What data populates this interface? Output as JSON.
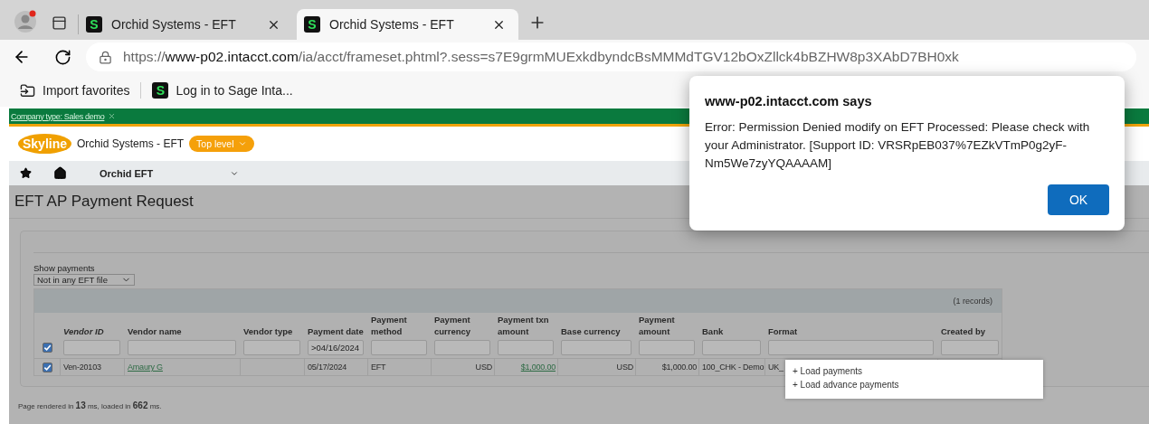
{
  "browser": {
    "tabs": [
      {
        "icon_letter": "S",
        "title": "Orchid Systems - EFT",
        "selected": false
      },
      {
        "icon_letter": "S",
        "title": "Orchid Systems - EFT",
        "selected": true
      }
    ],
    "address": {
      "scheme": "https://",
      "host": "www-p02.intacct.com",
      "path": "/ia/acct/frameset.phtml?.sess=s7E9grmMUExkdbyndcBsMMMdTGV12bOxZllck4bBZHW8p3XAbD7BH0xk"
    },
    "bookmarks": [
      {
        "kind": "import",
        "label": "Import favorites"
      },
      {
        "kind": "site",
        "icon_letter": "S",
        "label": "Log in to Sage Inta..."
      }
    ]
  },
  "banner": {
    "label": "Company type: Sales demo"
  },
  "header": {
    "logo": "Skyline",
    "company": "Orchid Systems - EFT",
    "level": "Top level"
  },
  "nav": {
    "menu": "Orchid EFT"
  },
  "page": {
    "title": "EFT AP Payment Request",
    "show_payments": {
      "label": "Show payments",
      "value": "Not in any EFT file"
    },
    "table": {
      "records": "(1 records)",
      "select_all": true,
      "columns": [
        {
          "label": "Vendor ID",
          "sorted": true
        },
        {
          "label": "Vendor name",
          "sorted": false
        },
        {
          "label": "Vendor type",
          "sorted": false
        },
        {
          "label": "Payment date",
          "sorted": false,
          "filter": ">04/16/2024"
        },
        {
          "label": "Payment method",
          "sorted": false
        },
        {
          "label": "Payment currency",
          "sorted": false
        },
        {
          "label": "Payment txn amount",
          "sorted": false
        },
        {
          "label": "Base currency",
          "sorted": false
        },
        {
          "label": "Payment amount",
          "sorted": false
        },
        {
          "label": "Bank",
          "sorted": false
        },
        {
          "label": "Format",
          "sorted": false
        },
        {
          "label": "Created by",
          "sorted": false
        }
      ],
      "rows": [
        {
          "selected": true,
          "cells": [
            {
              "kind": "text",
              "text": "Ven-20103"
            },
            {
              "kind": "link",
              "text": "Amaury G"
            },
            {
              "kind": "text",
              "text": ""
            },
            {
              "kind": "text",
              "text": "05/17/2024"
            },
            {
              "kind": "text",
              "text": "EFT"
            },
            {
              "kind": "amount",
              "text": "USD"
            },
            {
              "kind": "link_amount",
              "text": "$1,000.00"
            },
            {
              "kind": "amount",
              "text": "USD"
            },
            {
              "kind": "amount",
              "text": "$1,000.00"
            },
            {
              "kind": "text",
              "text": "100_CHK - Demo"
            },
            {
              "kind": "text",
              "text": "UK_"
            },
            {
              "kind": "text",
              "text": ""
            }
          ]
        }
      ]
    },
    "footer": "Page rendered in **13** ms, loaded in **662** ms."
  },
  "menu": {
    "items": [
      "+ Load payments",
      "+ Load advance payments"
    ]
  },
  "dialog": {
    "title": "www-p02.intacct.com says",
    "message": "Error: Permission Denied modify on EFT Processed: Please check with your Administrator. [Support ID: VRSRpEB037%7EZkVTmP0g2yF-Nm5We7zyYQAAAAM]",
    "button": "OK"
  }
}
